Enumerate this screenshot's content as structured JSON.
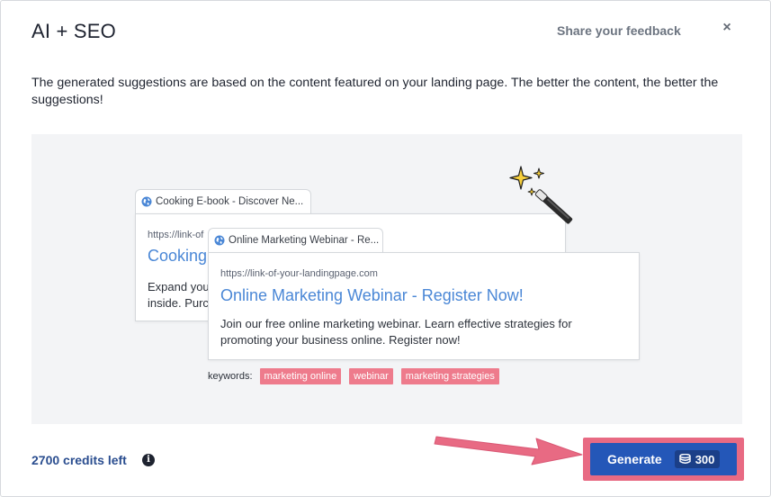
{
  "dialog": {
    "title": "AI + SEO",
    "feedback_label": "Share your feedback",
    "close_symbol": "×",
    "description": "The generated suggestions are based on the content featured on your landing page. The better the content, the better the suggestions!"
  },
  "preview": {
    "back": {
      "tab_title": "Cooking E-book - Discover Ne...",
      "url": "https://link-of",
      "headline": "Cooking",
      "body": "Expand you\ninside. Purc"
    },
    "front": {
      "tab_title": "Online Marketing Webinar - Re...",
      "url": "https://link-of-your-landingpage.com",
      "headline": "Online Marketing Webinar - Register Now!",
      "body": "Join our free online marketing webinar. Learn effective strategies for promoting your business online. Register now!"
    },
    "keywords_label": "keywords:",
    "keywords": [
      "marketing online",
      "webinar",
      "marketing strategies"
    ]
  },
  "footer": {
    "credits": "2700 credits left",
    "info_symbol": "i",
    "generate_label": "Generate",
    "generate_cost": "300"
  },
  "colors": {
    "accent_blue": "#2457b8",
    "highlight_pink": "#e86a83",
    "link_blue": "#4a87d6"
  }
}
